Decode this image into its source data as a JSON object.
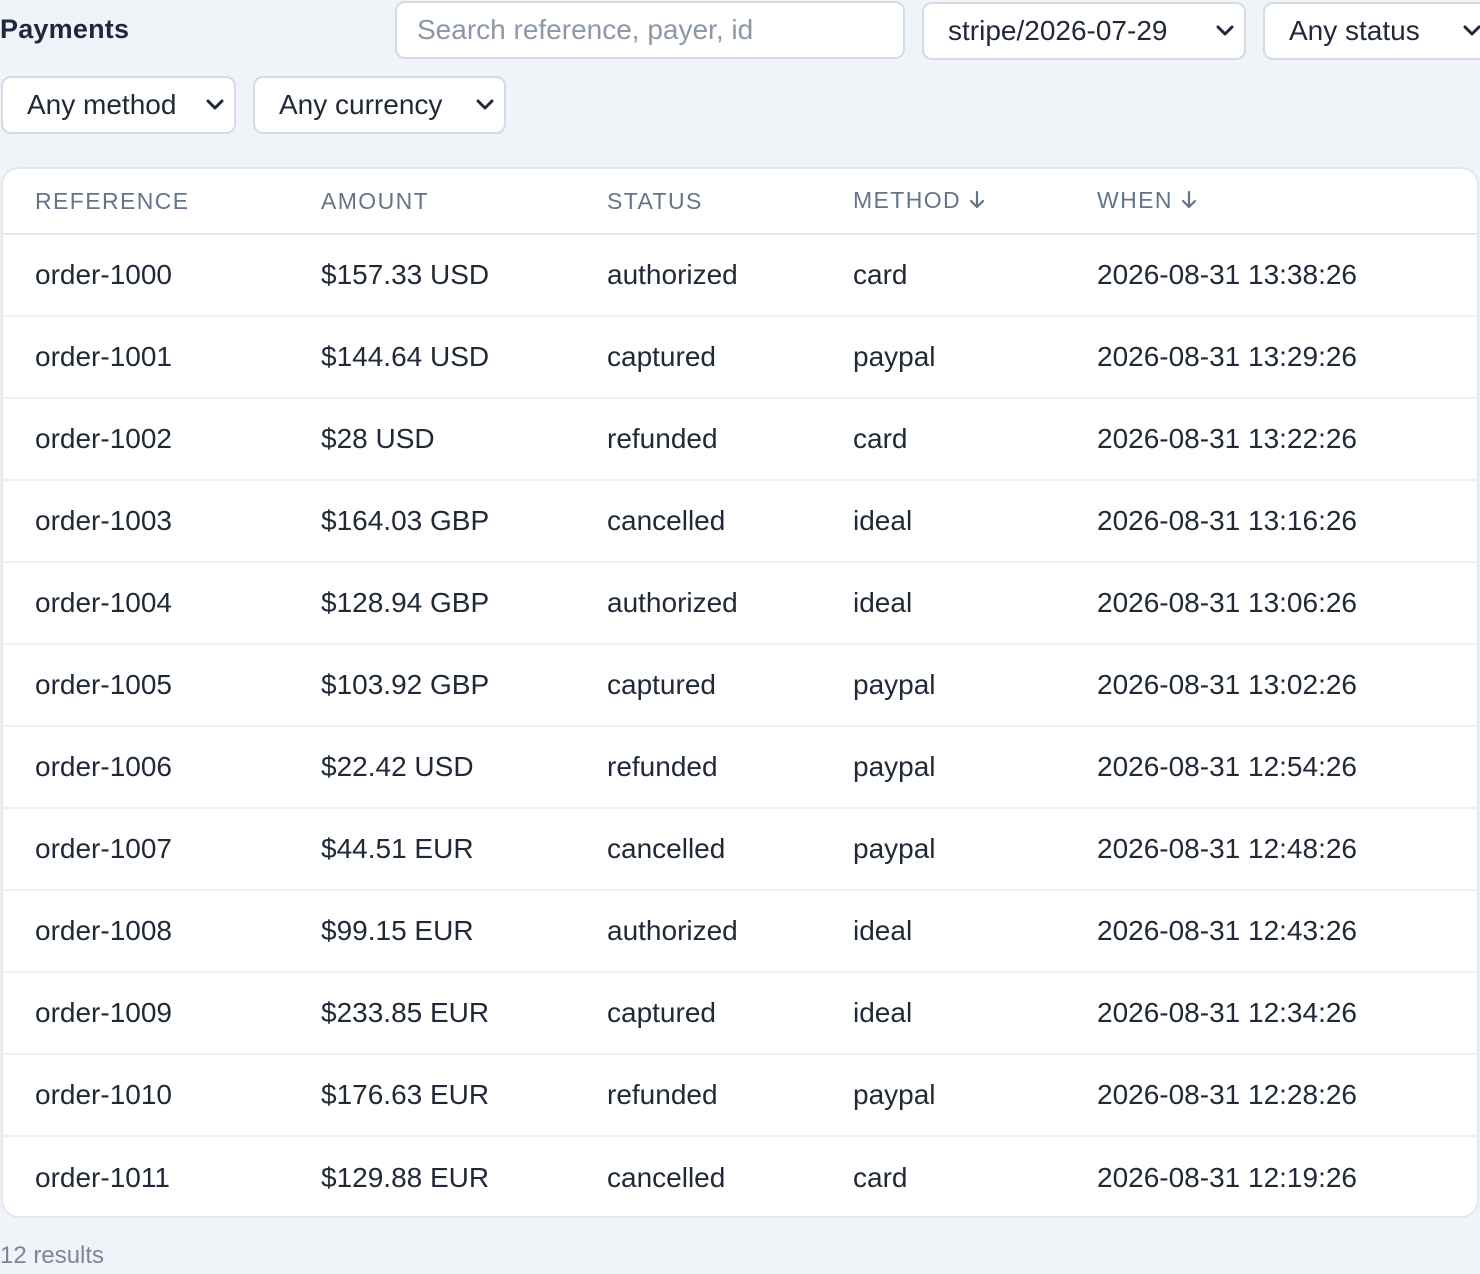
{
  "header": {
    "title": "Payments"
  },
  "filters": {
    "search_placeholder": "Search reference, payer, id",
    "search_value": "",
    "dataset": "stripe/2026-07-29",
    "status": "Any status",
    "method": "Any method",
    "currency": "Any currency"
  },
  "table": {
    "columns": [
      {
        "label": "REFERENCE",
        "sort": ""
      },
      {
        "label": "AMOUNT",
        "sort": ""
      },
      {
        "label": "STATUS",
        "sort": ""
      },
      {
        "label": "METHOD",
        "sort": "desc"
      },
      {
        "label": "WHEN",
        "sort": "desc"
      }
    ],
    "rows": [
      {
        "reference": "order-1000",
        "amount": "$157.33 USD",
        "status": "authorized",
        "method": "card",
        "when": "2026-08-31 13:38:26"
      },
      {
        "reference": "order-1001",
        "amount": "$144.64 USD",
        "status": "captured",
        "method": "paypal",
        "when": "2026-08-31 13:29:26"
      },
      {
        "reference": "order-1002",
        "amount": "$28 USD",
        "status": "refunded",
        "method": "card",
        "when": "2026-08-31 13:22:26"
      },
      {
        "reference": "order-1003",
        "amount": "$164.03 GBP",
        "status": "cancelled",
        "method": "ideal",
        "when": "2026-08-31 13:16:26"
      },
      {
        "reference": "order-1004",
        "amount": "$128.94 GBP",
        "status": "authorized",
        "method": "ideal",
        "when": "2026-08-31 13:06:26"
      },
      {
        "reference": "order-1005",
        "amount": "$103.92 GBP",
        "status": "captured",
        "method": "paypal",
        "when": "2026-08-31 13:02:26"
      },
      {
        "reference": "order-1006",
        "amount": "$22.42 USD",
        "status": "refunded",
        "method": "paypal",
        "when": "2026-08-31 12:54:26"
      },
      {
        "reference": "order-1007",
        "amount": "$44.51 EUR",
        "status": "cancelled",
        "method": "paypal",
        "when": "2026-08-31 12:48:26"
      },
      {
        "reference": "order-1008",
        "amount": "$99.15 EUR",
        "status": "authorized",
        "method": "ideal",
        "when": "2026-08-31 12:43:26"
      },
      {
        "reference": "order-1009",
        "amount": "$233.85 EUR",
        "status": "captured",
        "method": "ideal",
        "when": "2026-08-31 12:34:26"
      },
      {
        "reference": "order-1010",
        "amount": "$176.63 EUR",
        "status": "refunded",
        "method": "paypal",
        "when": "2026-08-31 12:28:26"
      },
      {
        "reference": "order-1011",
        "amount": "$129.88 EUR",
        "status": "cancelled",
        "method": "card",
        "when": "2026-08-31 12:19:26"
      }
    ]
  },
  "footer": {
    "results": "12 results"
  },
  "icons": {
    "select_chevron": "chevron-down-icon",
    "sort_indicator": "arrow-down-icon"
  },
  "colors": {
    "background": "#f0f4f8",
    "surface": "#ffffff",
    "border": "#d3dbe4",
    "text": "#1f2937",
    "muted": "#64748b"
  }
}
